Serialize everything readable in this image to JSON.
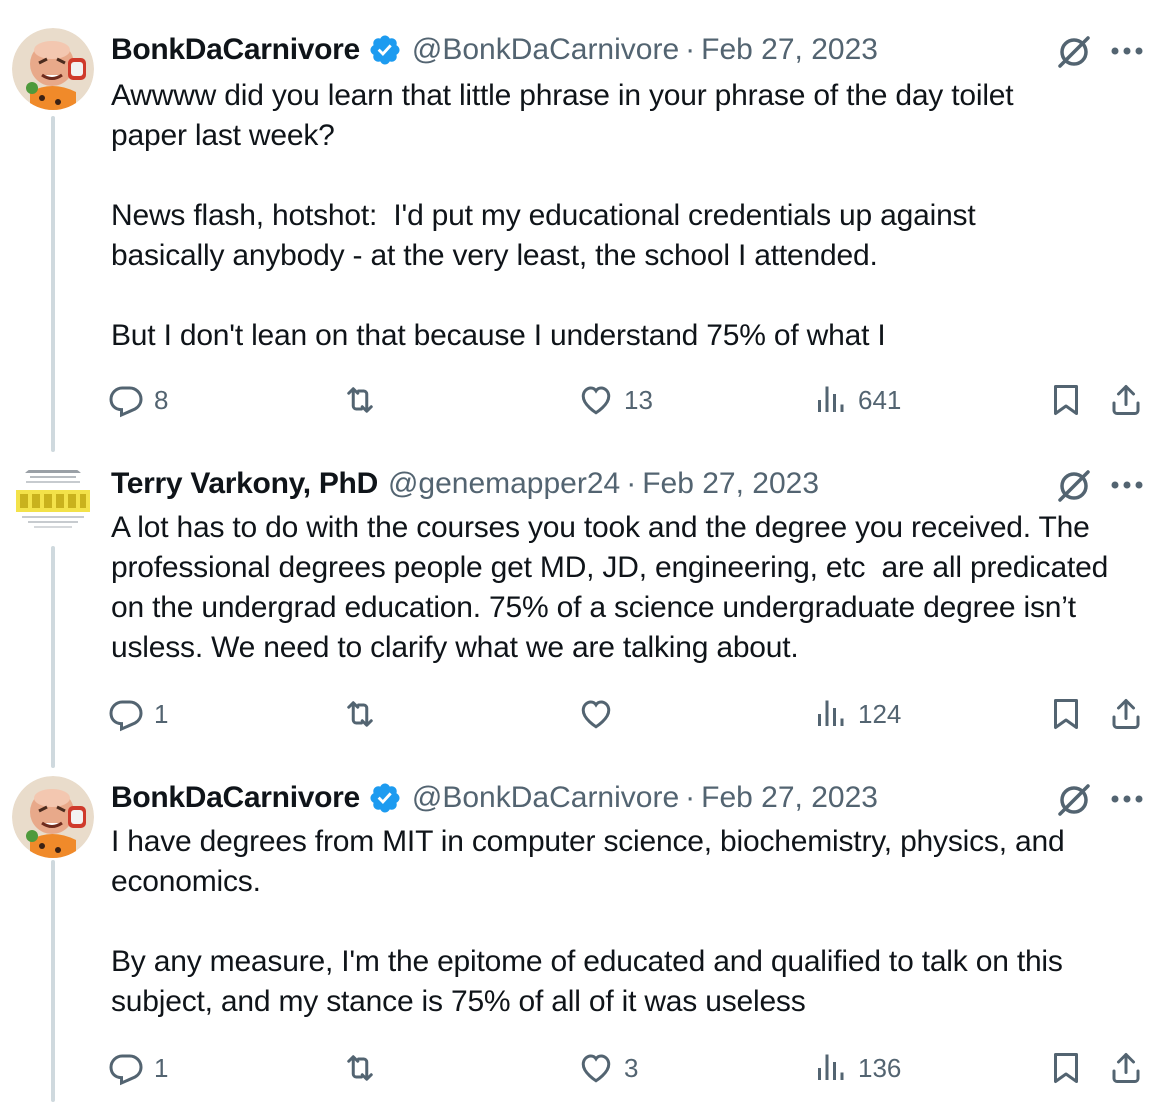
{
  "tweets": [
    {
      "name": "BonkDaCarnivore",
      "verified": true,
      "handle": "@BonkDaCarnivore",
      "separator": "·",
      "date": "Feb 27, 2023",
      "text": "Awwww did you learn that little phrase in your phrase of the day toilet\npaper last week?\n\nNews flash, hotshot:  I'd put my educational credentials up against\nbasically anybody - at the very least, the school I attended.\n\nBut I don't lean on that because I understand 75% of what I",
      "replies": "8",
      "retweets": "",
      "likes": "13",
      "views": "641"
    },
    {
      "name": "Terry Varkony, PhD",
      "verified": false,
      "handle": "@genemapper24",
      "separator": "·",
      "date": "Feb 27, 2023",
      "text": "A lot has to do with the courses you took and the degree you received. The\nprofessional degrees people get MD, JD, engineering, etc  are all predicated\non the undergrad education. 75% of a science undergraduate degree isn’t\nusless. We need to clarify what we are talking about.",
      "replies": "1",
      "retweets": "",
      "likes": "",
      "views": "124"
    },
    {
      "name": "BonkDaCarnivore",
      "verified": true,
      "handle": "@BonkDaCarnivore",
      "separator": "·",
      "date": "Feb 27, 2023",
      "text": "I have degrees from MIT in computer science, biochemistry, physics, and\neconomics.\n\nBy any measure, I'm the epitome of educated and qualified to talk on this\nsubject, and my stance is 75% of all of it was useless",
      "replies": "1",
      "retweets": "",
      "likes": "3",
      "views": "136"
    }
  ],
  "colors": {
    "text": "#0f1419",
    "secondary": "#536471",
    "verified": "#1d9bf0",
    "thread_line": "#cfd9de"
  },
  "icons": [
    "reply-icon",
    "retweet-icon",
    "like-icon",
    "views-icon",
    "bookmark-icon",
    "share-icon",
    "grok-icon",
    "more-icon",
    "verified-badge-icon"
  ]
}
